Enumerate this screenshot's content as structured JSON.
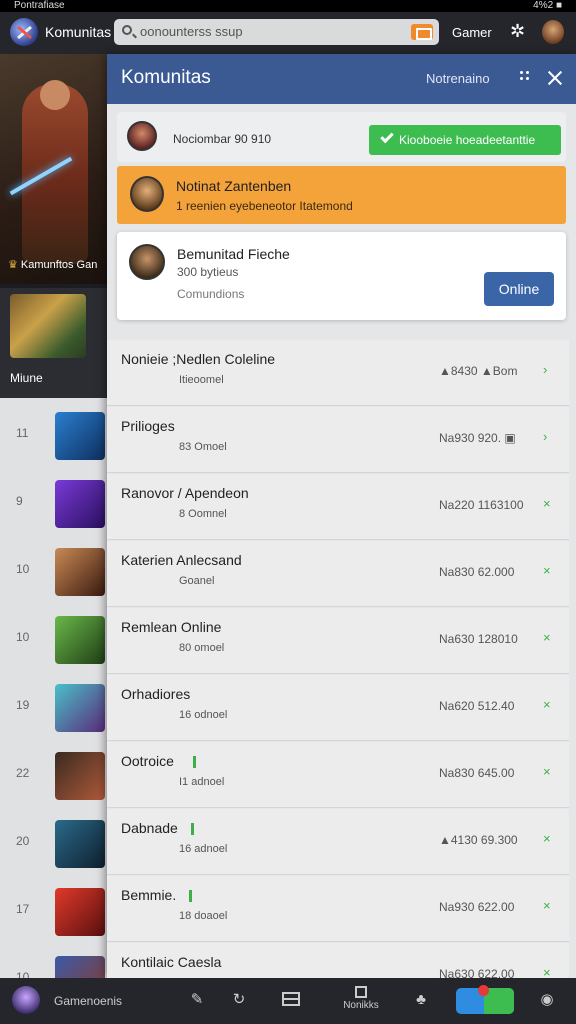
{
  "status_bar": {
    "left_text": "Pontrafiase",
    "right_text": "4%2 ■"
  },
  "topbar": {
    "app_name": "Komunitas",
    "search_placeholder": "oonounterss ssup",
    "games_label": "Gamer"
  },
  "background": {
    "hero_caption": "Kamunftos Gan",
    "game_tile_label": "Miune",
    "left_numbers": [
      "11",
      "9",
      "10",
      "10",
      "19",
      "22",
      "20",
      "17",
      "10"
    ]
  },
  "panel": {
    "title": "Komunitas",
    "notifications_label": "Notrenaino",
    "notify_bar": {
      "text": "Nociombar 90 910",
      "button_label": "Kiooboeie hoeadeetanttie"
    },
    "highlight_card": {
      "title": "Notinat Zantenben",
      "subtitle": "1 reenien eyebeneotor Itatemond"
    },
    "community_card": {
      "title": "Bemunitad Fieche",
      "count": "300 bytieus",
      "label": "Comundions",
      "button_label": "Online"
    },
    "list": [
      {
        "name": "Nonieie ;Nedlen Coleline",
        "sub": "Itieoomel",
        "stat": "▲8430 ▲Bom"
      },
      {
        "name": "Prilioges",
        "sub": "83 Omoel",
        "stat": "Na930 920. ▣"
      },
      {
        "name": "Ranovor / Apendeon",
        "sub": "8 Oomnel",
        "stat": "Na220 1163100"
      },
      {
        "name": "Katerien Anlecsand",
        "sub": "Goanel",
        "stat": "Na830 62.000"
      },
      {
        "name": "Remlean Online",
        "sub": "80 omoel",
        "stat": "Na630 128010"
      },
      {
        "name": "Orhadiores",
        "sub": "16 odnoel",
        "stat": "Na620 512.40"
      },
      {
        "name": "Ootroice",
        "sub": "I1 adnoel",
        "stat": "Na830 645.00"
      },
      {
        "name": "Dabnade",
        "sub": "16 adnoel",
        "stat": "▲4130 69.300"
      },
      {
        "name": "Bemmie.",
        "sub": "18 doaoel",
        "stat": "Na930 622.00"
      },
      {
        "name": "Kontilaic Caesla",
        "sub": "",
        "stat": "Na630 622.00"
      }
    ]
  },
  "bottom_nav": {
    "label": "Gamenoenis",
    "center_label": "Nonikks"
  },
  "colors": {
    "header_blue": "#3b5a94",
    "orange": "#f4a23a",
    "green": "#3dbd4f",
    "button_blue": "#3a66a8"
  }
}
